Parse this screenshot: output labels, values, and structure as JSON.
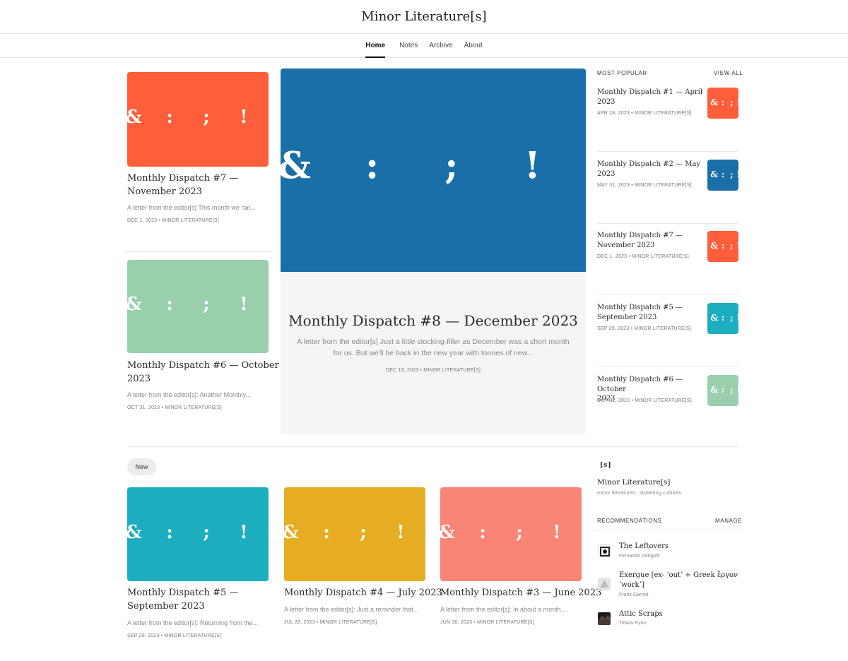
{
  "site": {
    "title": "Minor Literature[s]"
  },
  "nav": [
    "Home",
    "Notes",
    "Archive",
    "About"
  ],
  "colors": {
    "orange": "#ff5e3a",
    "blue": "#1b6fa8",
    "green": "#9acfad",
    "teal": "#1caebf",
    "yellow": "#e6ad22",
    "salmon": "#f88576"
  },
  "glyphs": [
    "&",
    ":",
    ";",
    "!"
  ],
  "featured": {
    "title": "Monthly Dispatch #8 — December 2023",
    "excerpt_line1": "A letter from the editor[s] Just a little stocking-filler as December was a short month",
    "excerpt_line2": "for us. But we'll be back in the new year with tonnes of new...",
    "meta": "DEC 19, 2023 • MINOR LITERATURE[S]"
  },
  "left_posts": [
    {
      "title_l1": "Monthly Dispatch #7 —",
      "title_l2": "November 2023",
      "excerpt": "A letter from the editor[s] This month we ran...",
      "meta": "DEC 1, 2023 • MINOR LITERATURE[S]"
    },
    {
      "title_l1": "Monthly Dispatch #6 — October",
      "title_l2": "2023",
      "excerpt": "A letter from the editor[s]: Another Monthly...",
      "meta": "OCT 31, 2023 • MINOR LITERATURE[S]"
    }
  ],
  "popular": {
    "heading": "MOST POPULAR",
    "view_all": "VIEW ALL",
    "items": [
      {
        "title_l1": "Monthly Dispatch #1 — April",
        "title_l2": "2023",
        "meta": "APR 28, 2023 • MINOR LITERATURE[S]"
      },
      {
        "title_l1": "Monthly Dispatch #2 — May",
        "title_l2": "2023",
        "meta": "MAY 31, 2023 • MINOR LITERATURE[S]"
      },
      {
        "title_l1": "Monthly Dispatch #7 —",
        "title_l2": "November 2023",
        "meta": "DEC 1, 2023 • MINOR LITERATURE[S]"
      },
      {
        "title_l1": "Monthly Dispatch #5 —",
        "title_l2": "September 2023",
        "meta": "SEP 29, 2023 • MINOR LITERATURE[S]"
      },
      {
        "title_l1": "Monthly Dispatch #6 — October",
        "title_l2": "2023",
        "meta": "OCT 31, 2023 • MINOR LITERATURE[S]"
      }
    ]
  },
  "new_section": {
    "pill": "New",
    "posts": [
      {
        "title_l1": "Monthly Dispatch #5 —",
        "title_l2": "September 2023",
        "excerpt": "A letter from the editor[s]: Returning from the...",
        "meta": "SEP 29, 2023 • MINOR LITERATURE[S]"
      },
      {
        "title_l1": "Monthly Dispatch #4 — July 2023",
        "title_l2": "",
        "excerpt": "A letter from the editor[s]: Just a reminder that...",
        "meta": "JUL 28, 2023 • MINOR LITERATURE[S]"
      },
      {
        "title_l1": "Monthly Dispatch #3 — June 2023",
        "title_l2": "",
        "excerpt": "A letter from the editor[s]: In about a month,...",
        "meta": "JUN 30, 2023 • MINOR LITERATURE[S]"
      }
    ]
  },
  "publication": {
    "logo": "[s]",
    "name": "Minor Literature[s]",
    "tagline": "minor literatures ; stuttering cultures"
  },
  "recommendations": {
    "heading": "RECOMMENDATIONS",
    "manage": "MANAGE",
    "items": [
      {
        "name_l1": "The Leftovers",
        "name_l2": "",
        "author": "Fernando Sdrigotti"
      },
      {
        "name_l1": "Exergue [ex- ‘out’ + Greek ἔργον",
        "name_l2": "‘work’]",
        "author": "Frank Garrett"
      },
      {
        "name_l1": "Attic Scraps",
        "name_l2": "",
        "author": "Tobias Ryan"
      }
    ]
  }
}
